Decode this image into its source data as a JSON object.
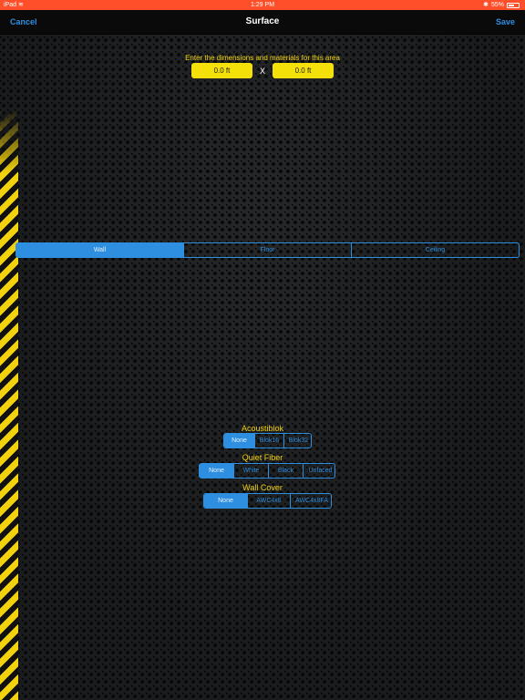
{
  "status_bar": {
    "device": "iPad",
    "time": "1:29 PM",
    "battery": "55%"
  },
  "nav": {
    "cancel_label": "Cancel",
    "title": "Surface",
    "save_label": "Save"
  },
  "form": {
    "prompt": "Enter the dimensions and materials for this area",
    "width_value": "0.0 ft",
    "height_value": "0.0 ft",
    "separator": "X"
  },
  "surface_types": [
    "Wall",
    "Floor",
    "Ceiling"
  ],
  "surface_selected": "Wall",
  "materials": {
    "acoustiblok": {
      "title": "Acoustiblok",
      "options": [
        "None",
        "Blok16",
        "Blok32"
      ],
      "selected": "None"
    },
    "quiet_fiber": {
      "title": "Quiet Fiber",
      "options": [
        "None",
        "White",
        "Black",
        "Unfaced"
      ],
      "selected": "None"
    },
    "wall_cover": {
      "title": "Wall Cover",
      "options": [
        "None",
        "AWC4x8",
        "AWC4x8FA"
      ],
      "selected": "None"
    }
  },
  "colors": {
    "accent": "#2e8fe0",
    "yellow": "#f2d20c",
    "status_bar": "#ff4f2a"
  }
}
